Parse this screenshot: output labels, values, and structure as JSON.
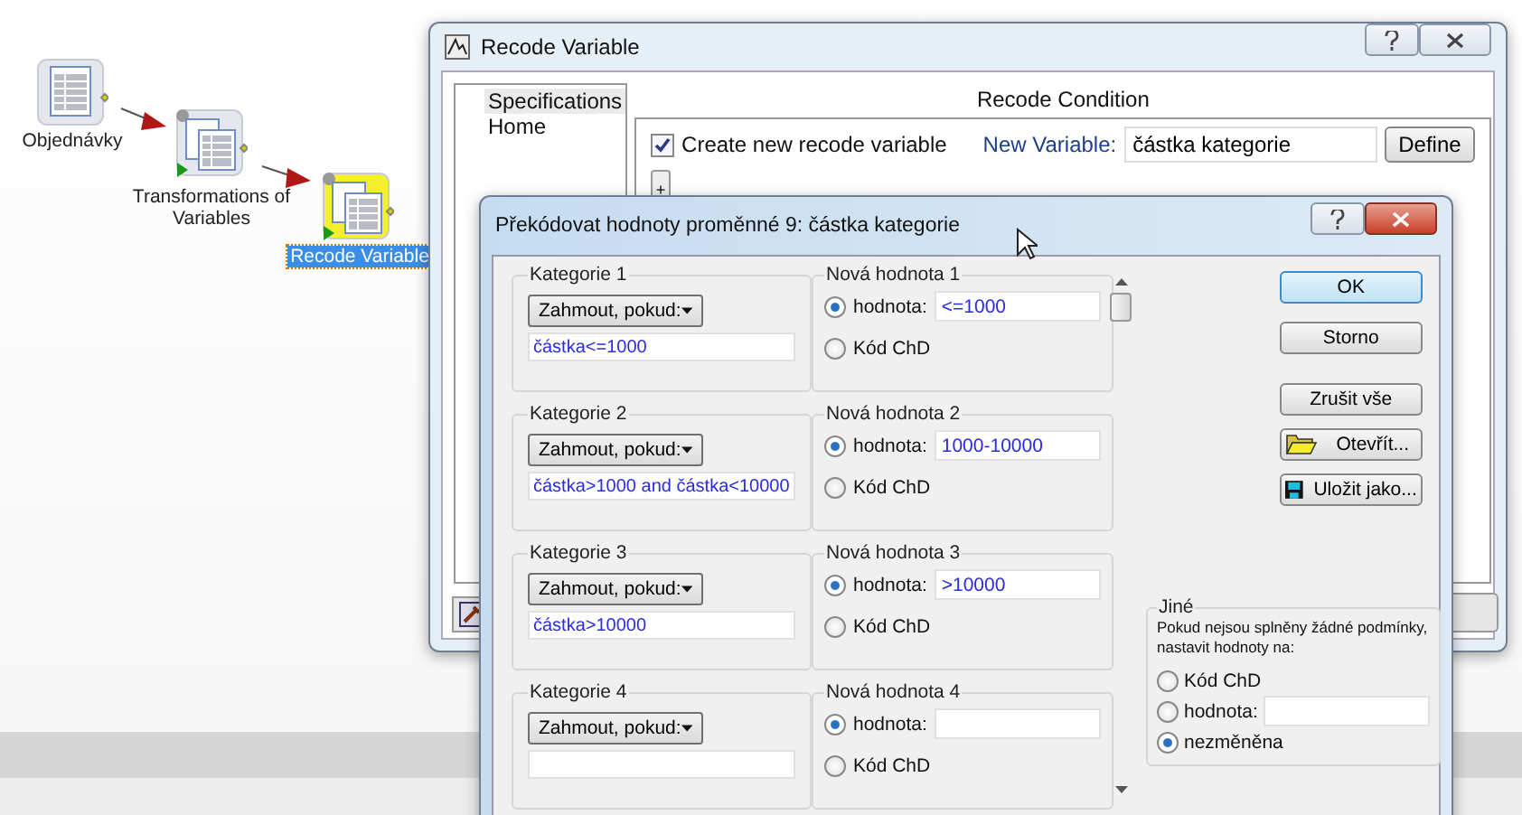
{
  "canvas": {
    "nodes": [
      {
        "label": "Objednávky",
        "selected": false,
        "kind": "source"
      },
      {
        "label": "Transformations of Variables",
        "selected": false,
        "kind": "transform"
      },
      {
        "label": "Recode Variable",
        "selected": true,
        "kind": "transform"
      }
    ]
  },
  "recode_window": {
    "title": "Recode Variable",
    "sidebar": {
      "items": [
        {
          "label": "Specifications",
          "selected": true
        },
        {
          "label": "Home",
          "selected": false
        }
      ]
    },
    "section_title": "Recode Condition",
    "create_new": {
      "label": "Create new recode variable",
      "checked": true
    },
    "new_variable": {
      "label": "New Variable:",
      "value": "částka kategorie"
    },
    "define_button": "Define",
    "add_button": "+"
  },
  "dialog": {
    "title": "Překódovat hodnoty proměnné 9: částka kategorie",
    "categories": [
      {
        "label": "Kategorie 1",
        "mode": "Zahmout, pokud:",
        "condition": "částka<=1000",
        "new_label": "Nová hodnota 1",
        "options": [
          {
            "kind": "value",
            "label": "hodnota:",
            "selected": true,
            "value": "<=1000"
          },
          {
            "kind": "code",
            "label": "Kód ChD",
            "selected": false
          }
        ]
      },
      {
        "label": "Kategorie 2",
        "mode": "Zahmout, pokud:",
        "condition": "částka>1000 and částka<10000",
        "new_label": "Nová hodnota 2",
        "options": [
          {
            "kind": "value",
            "label": "hodnota:",
            "selected": true,
            "value": "1000-10000"
          },
          {
            "kind": "code",
            "label": "Kód ChD",
            "selected": false
          }
        ]
      },
      {
        "label": "Kategorie 3",
        "mode": "Zahmout, pokud:",
        "condition": "částka>10000",
        "new_label": "Nová hodnota 3",
        "options": [
          {
            "kind": "value",
            "label": "hodnota:",
            "selected": true,
            "value": ">10000"
          },
          {
            "kind": "code",
            "label": "Kód ChD",
            "selected": false
          }
        ]
      },
      {
        "label": "Kategorie 4",
        "mode": "Zahmout, pokud:",
        "new_label": "Nová hodnota 4",
        "options": [
          {
            "kind": "value",
            "label": "hodnota:",
            "selected": true
          },
          {
            "kind": "code",
            "label": "Kód ChD",
            "selected": false
          }
        ]
      }
    ],
    "buttons": [
      {
        "label": "OK",
        "default": true
      },
      {
        "label": "Storno",
        "default": false
      },
      {
        "label": "Zrušit vše",
        "default": false
      },
      {
        "label": "Otevřít...",
        "default": false,
        "kind": "folder"
      },
      {
        "label": "Uložit jako...",
        "default": false,
        "kind": "disk"
      }
    ],
    "other": {
      "title": "Jiné",
      "note": "Pokud nejsou splněny žádné podmínky, nastavit hodnoty na:",
      "options": [
        {
          "kind": "code",
          "label": "Kód ChD",
          "selected": false
        },
        {
          "kind": "value",
          "label": "hodnota:",
          "selected": false
        },
        {
          "kind": "plain",
          "label": "nezměněna",
          "selected": true
        }
      ]
    }
  }
}
